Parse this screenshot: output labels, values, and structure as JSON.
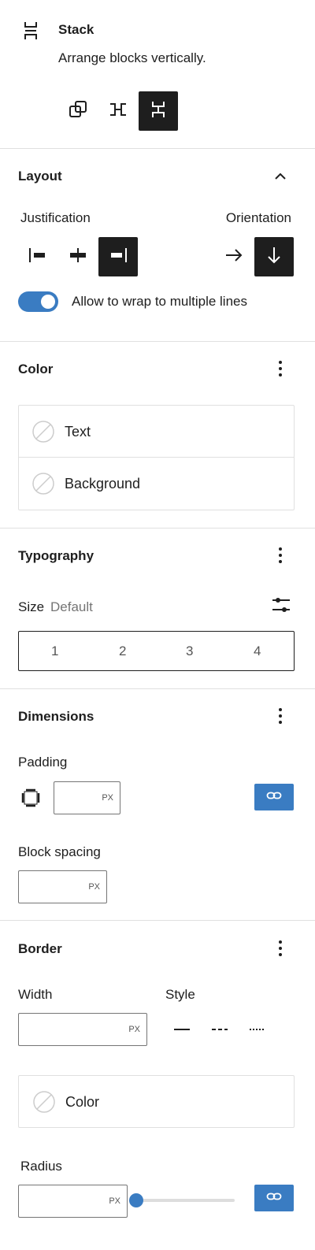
{
  "block": {
    "icon": "stack-icon",
    "name": "Stack",
    "description": "Arrange blocks vertically.",
    "variations": [
      {
        "name": "group-icon",
        "active": false
      },
      {
        "name": "row-icon",
        "active": false
      },
      {
        "name": "stack-icon",
        "active": true
      }
    ]
  },
  "layout": {
    "title": "Layout",
    "justification_label": "Justification",
    "orientation_label": "Orientation",
    "justification_options": [
      "justify-left-icon",
      "justify-center-icon",
      "justify-right-icon"
    ],
    "justification_selected": "justify-right-icon",
    "orientation_options": [
      "arrow-right-icon",
      "arrow-down-icon"
    ],
    "orientation_selected": "arrow-down-icon",
    "wrap_label": "Allow to wrap to multiple lines",
    "wrap_enabled": true
  },
  "color": {
    "title": "Color",
    "items": [
      "Text",
      "Background"
    ]
  },
  "typography": {
    "title": "Typography",
    "size_label": "Size",
    "size_value": "Default",
    "size_options": [
      "1",
      "2",
      "3",
      "4"
    ]
  },
  "dimensions": {
    "title": "Dimensions",
    "padding_label": "Padding",
    "padding_unit": "PX",
    "block_spacing_label": "Block spacing",
    "block_spacing_unit": "PX"
  },
  "border": {
    "title": "Border",
    "width_label": "Width",
    "width_unit": "PX",
    "style_label": "Style",
    "style_options": [
      "solid-line-icon",
      "dashed-line-icon",
      "dotted-line-icon"
    ],
    "color_label": "Color",
    "radius_label": "Radius",
    "radius_unit": "PX",
    "radius_slider_value": 0
  },
  "colors": {
    "accent": "#3a7cc2",
    "dark": "#1e1e1e",
    "border": "#e0e0e0"
  }
}
